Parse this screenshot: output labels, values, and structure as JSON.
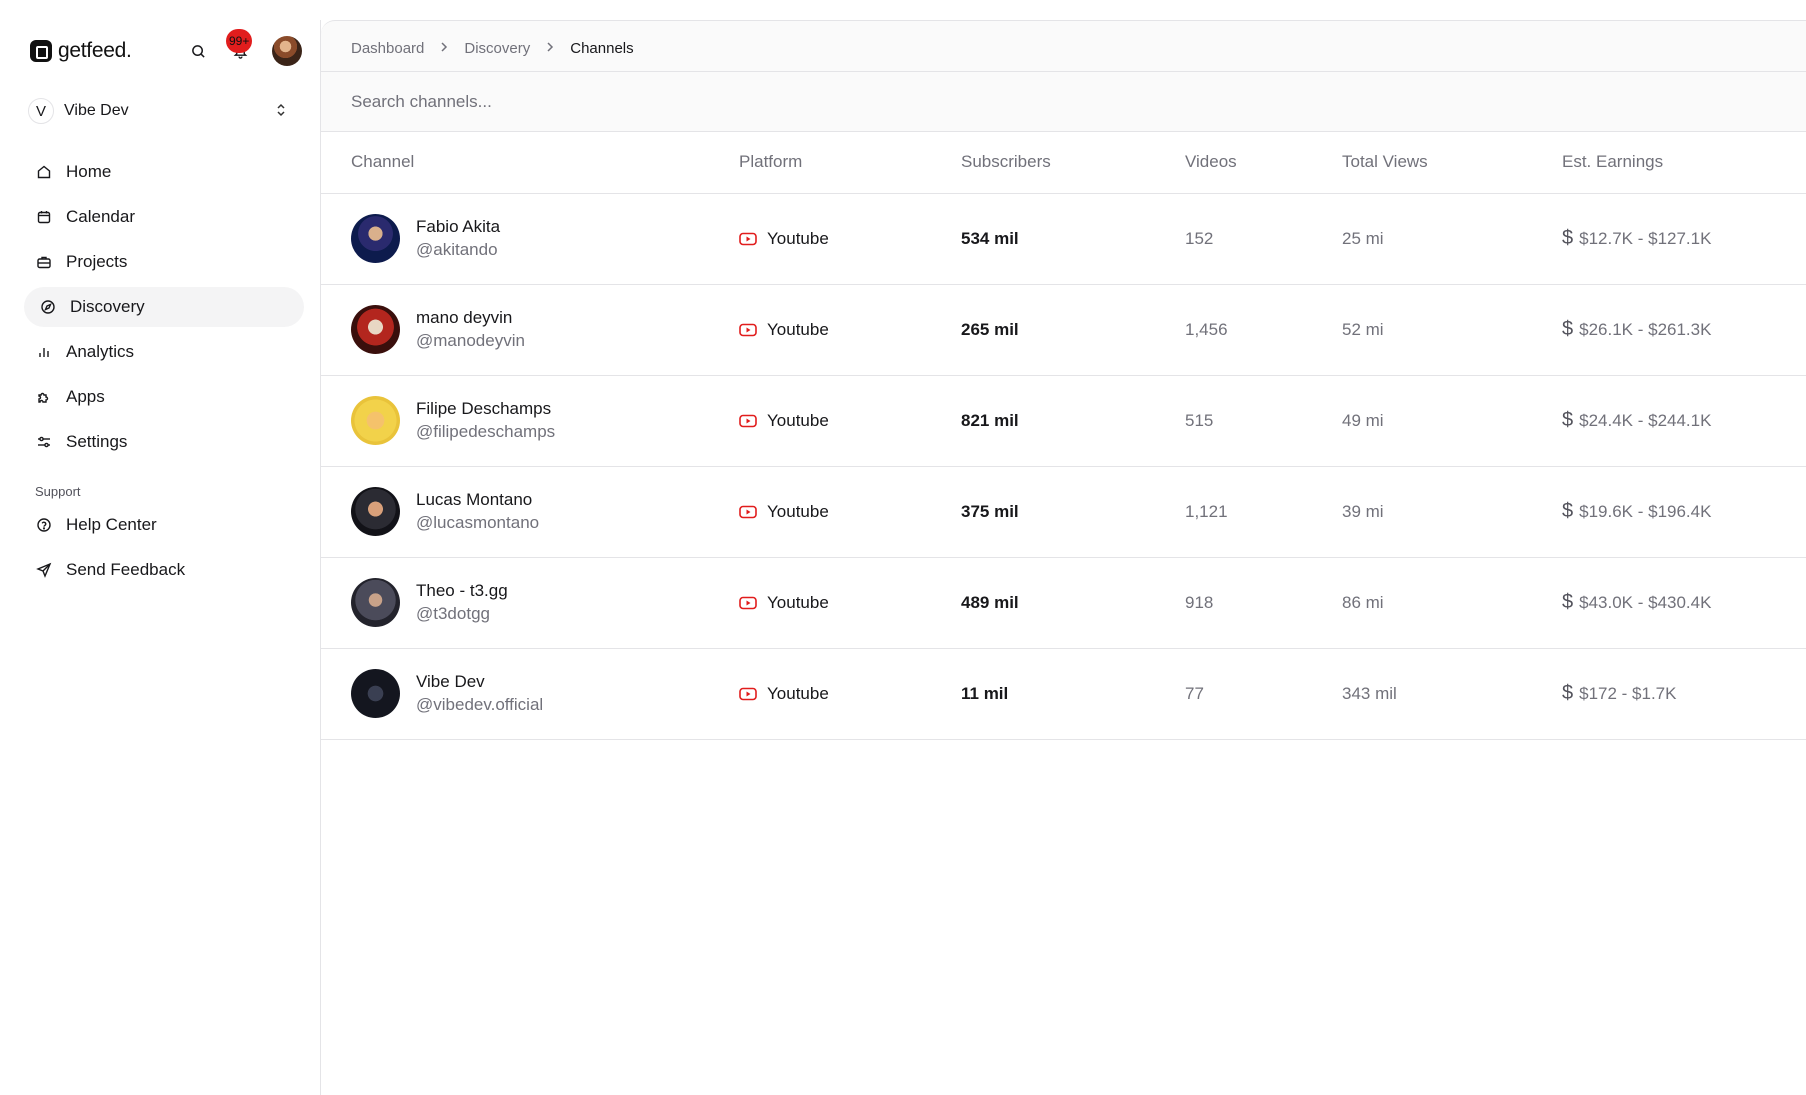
{
  "app": {
    "name": "getfeed."
  },
  "topbar": {
    "notification_count": "99+"
  },
  "workspace": {
    "initial": "V",
    "name": "Vibe Dev"
  },
  "nav": {
    "items": [
      {
        "label": "Home",
        "icon": "home-icon"
      },
      {
        "label": "Calendar",
        "icon": "calendar-icon"
      },
      {
        "label": "Projects",
        "icon": "briefcase-icon"
      },
      {
        "label": "Discovery",
        "icon": "compass-icon",
        "active": true
      },
      {
        "label": "Analytics",
        "icon": "bar-chart-icon"
      },
      {
        "label": "Apps",
        "icon": "puzzle-icon"
      },
      {
        "label": "Settings",
        "icon": "sliders-icon"
      }
    ],
    "support_label": "Support",
    "support_items": [
      {
        "label": "Help Center",
        "icon": "help-circle-icon"
      },
      {
        "label": "Send Feedback",
        "icon": "send-icon"
      }
    ]
  },
  "breadcrumb": [
    "Dashboard",
    "Discovery",
    "Channels"
  ],
  "search": {
    "placeholder": "Search channels..."
  },
  "table": {
    "columns": [
      "Channel",
      "Platform",
      "Subscribers",
      "Videos",
      "Total Views",
      "Est. Earnings"
    ],
    "rows": [
      {
        "name": "Fabio Akita",
        "handle": "@akitando",
        "platform": "Youtube",
        "subscribers": "534 mil",
        "videos": "152",
        "views": "25 mi",
        "earnings": "$12.7K - $127.1K"
      },
      {
        "name": "mano deyvin",
        "handle": "@manodeyvin",
        "platform": "Youtube",
        "subscribers": "265 mil",
        "videos": "1,456",
        "views": "52 mi",
        "earnings": "$26.1K - $261.3K"
      },
      {
        "name": "Filipe Deschamps",
        "handle": "@filipedeschamps",
        "platform": "Youtube",
        "subscribers": "821 mil",
        "videos": "515",
        "views": "49 mi",
        "earnings": "$24.4K - $244.1K"
      },
      {
        "name": "Lucas Montano",
        "handle": "@lucasmontano",
        "platform": "Youtube",
        "subscribers": "375 mil",
        "videos": "1,121",
        "views": "39 mi",
        "earnings": "$19.6K - $196.4K"
      },
      {
        "name": "Theo - t3.gg",
        "handle": "@t3dotgg",
        "platform": "Youtube",
        "subscribers": "489 mil",
        "videos": "918",
        "views": "86 mi",
        "earnings": "$43.0K - $430.4K"
      },
      {
        "name": "Vibe Dev",
        "handle": "@vibedev.official",
        "platform": "Youtube",
        "subscribers": "11 mil",
        "videos": "77",
        "views": "343 mil",
        "earnings": "$172 - $1.7K"
      }
    ]
  },
  "colors": {
    "youtube_red": "#e11d1d",
    "text": "#18181b",
    "muted": "#71717a",
    "border": "#e4e4e7",
    "active_bg": "#f4f4f5"
  }
}
